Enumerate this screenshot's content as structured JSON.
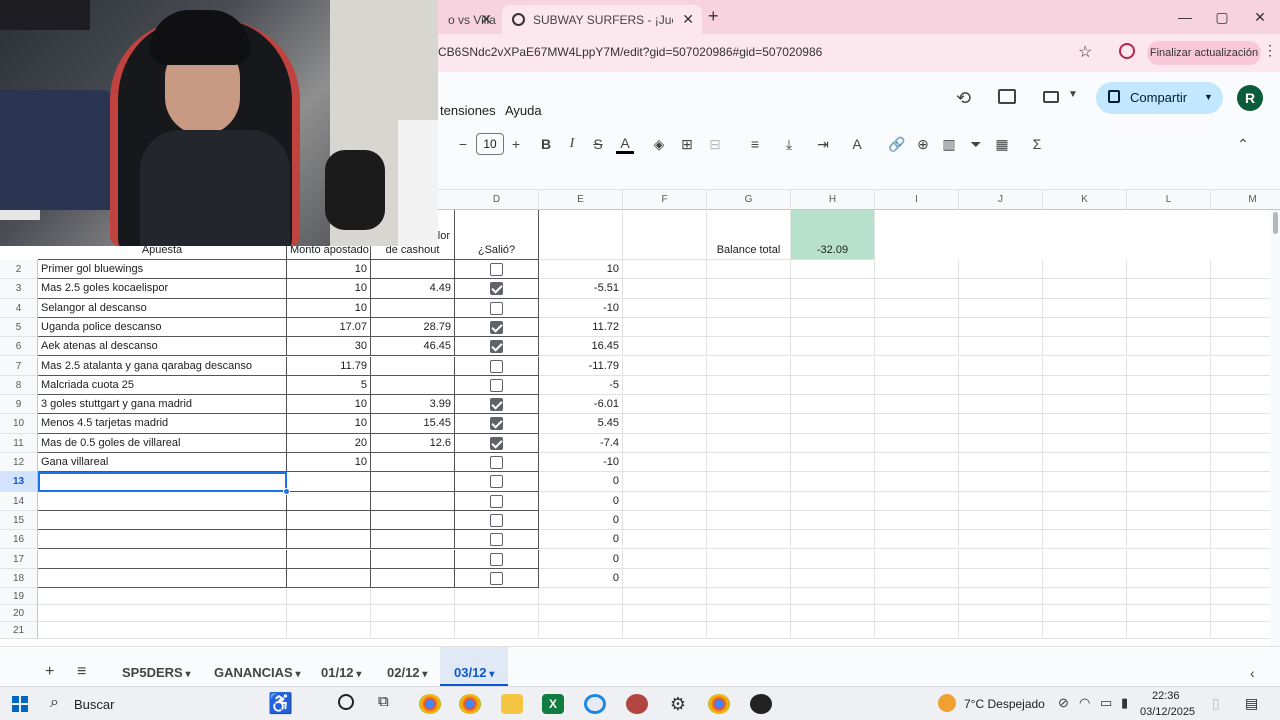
{
  "browser": {
    "tabs": [
      {
        "label": "o vs Villa",
        "active": false
      },
      {
        "label": "SUBWAY SURFERS - ¡Juega Gra",
        "active": true
      }
    ],
    "new_tab": "+",
    "url": "CB6SNdc2vXPaE67MW4LppY7M/edit?gid=507020986#gid=507020986",
    "update_button": "Finalizar actualización",
    "minimize": "—",
    "maximize": "▢",
    "close": "✕"
  },
  "sheets_header": {
    "menu_items": [
      "tensiones",
      "Ayuda"
    ],
    "share_button": "Compartir",
    "avatar_letter": "R",
    "font_size": "10"
  },
  "columns": [
    "D",
    "E",
    "F",
    "G",
    "H",
    "I",
    "J",
    "K",
    "L",
    "M"
  ],
  "header_row": {
    "apuesta": "Apuesta",
    "monto": "Monto apostado",
    "cashout_top": "lor",
    "cashout": "de cashout",
    "salio": "¿Salió?",
    "balance_label": "Balance total",
    "balance_value": "-32.09"
  },
  "rows": [
    {
      "n": "2",
      "apuesta": "Primer gol bluewings",
      "monto": "10",
      "cashout": "",
      "salio": false,
      "e": "10"
    },
    {
      "n": "3",
      "apuesta": "Mas 2.5 goles kocaelispor",
      "monto": "10",
      "cashout": "4.49",
      "salio": true,
      "e": "-5.51"
    },
    {
      "n": "4",
      "apuesta": "Selangor al descanso",
      "monto": "10",
      "cashout": "",
      "salio": false,
      "e": "-10"
    },
    {
      "n": "5",
      "apuesta": "Uganda police descanso",
      "monto": "17.07",
      "cashout": "28.79",
      "salio": true,
      "e": "11.72"
    },
    {
      "n": "6",
      "apuesta": "Aek atenas al descanso",
      "monto": "30",
      "cashout": "46.45",
      "salio": true,
      "e": "16.45"
    },
    {
      "n": "7",
      "apuesta": "Mas 2.5 atalanta y gana qarabag descanso",
      "monto": "11.79",
      "cashout": "",
      "salio": false,
      "e": "-11.79"
    },
    {
      "n": "8",
      "apuesta": "Malcriada cuota 25",
      "monto": "5",
      "cashout": "",
      "salio": false,
      "e": "-5"
    },
    {
      "n": "9",
      "apuesta": "3 goles stuttgart y gana madrid",
      "monto": "10",
      "cashout": "3.99",
      "salio": true,
      "e": "-6.01"
    },
    {
      "n": "10",
      "apuesta": "Menos 4.5 tarjetas madrid",
      "monto": "10",
      "cashout": "15.45",
      "salio": true,
      "e": "5.45"
    },
    {
      "n": "11",
      "apuesta": "Mas de 0.5 goles de villareal",
      "monto": "20",
      "cashout": "12.6",
      "salio": true,
      "e": "-7.4"
    },
    {
      "n": "12",
      "apuesta": "Gana villareal",
      "monto": "10",
      "cashout": "",
      "salio": false,
      "e": "-10"
    },
    {
      "n": "13",
      "apuesta": "",
      "monto": "",
      "cashout": "",
      "salio": false,
      "e": "0"
    },
    {
      "n": "14",
      "apuesta": "",
      "monto": "",
      "cashout": "",
      "salio": false,
      "e": "0"
    },
    {
      "n": "15",
      "apuesta": "",
      "monto": "",
      "cashout": "",
      "salio": false,
      "e": "0"
    },
    {
      "n": "16",
      "apuesta": "",
      "monto": "",
      "cashout": "",
      "salio": false,
      "e": "0"
    },
    {
      "n": "17",
      "apuesta": "",
      "monto": "",
      "cashout": "",
      "salio": false,
      "e": "0"
    },
    {
      "n": "18",
      "apuesta": "",
      "monto": "",
      "cashout": "",
      "salio": false,
      "e": "0"
    }
  ],
  "empty_rows": [
    "19",
    "20",
    "21"
  ],
  "sheet_tabs": [
    {
      "label": "SP5DERS",
      "active": false
    },
    {
      "label": "GANANCIAS",
      "active": false
    },
    {
      "label": "01/12",
      "active": false
    },
    {
      "label": "02/12",
      "active": false
    },
    {
      "label": "03/12",
      "active": true
    }
  ],
  "taskbar": {
    "search": "Buscar",
    "weather": "7°C Despejado",
    "time": "22:36",
    "date": "03/12/2025"
  },
  "colors": {
    "tabbar": "#f6d3df",
    "balance_fill": "#b7e1cd",
    "selection": "#1a73e8",
    "share_bg": "#c2e7ff"
  }
}
